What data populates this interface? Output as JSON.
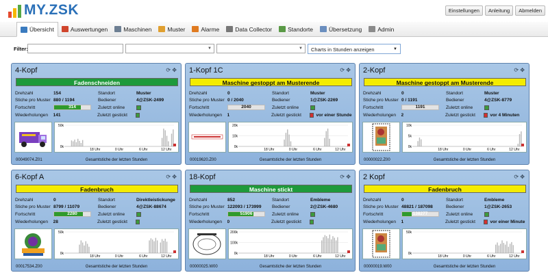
{
  "app": {
    "logo": "MY.ZSK",
    "buttons": [
      "Einstellungen",
      "Anleitung",
      "Abmelden"
    ]
  },
  "nav": [
    {
      "label": "Übersicht",
      "icon": "home-icon",
      "color": "#3b7bbf",
      "active": true
    },
    {
      "label": "Auswertungen",
      "icon": "bar-chart-icon",
      "color": "#d0452c"
    },
    {
      "label": "Maschinen",
      "icon": "machine-icon",
      "color": "#6d7f93"
    },
    {
      "label": "Muster",
      "icon": "pattern-icon",
      "color": "#e0a030"
    },
    {
      "label": "Alarme",
      "icon": "alarm-icon",
      "color": "#e07b21"
    },
    {
      "label": "Data Collector",
      "icon": "gear-icon",
      "color": "#777777"
    },
    {
      "label": "Standorte",
      "icon": "location-icon",
      "color": "#5a9a46"
    },
    {
      "label": "Übersetzung",
      "icon": "translate-icon",
      "color": "#6b8fbf"
    },
    {
      "label": "Admin",
      "icon": "admin-icon",
      "color": "#8b8b8b"
    }
  ],
  "filter": {
    "label": "Filter:",
    "chart_mode": "Charts in Stunden anzeigen"
  },
  "labels": {
    "drehzahl": "Drehzahl",
    "stiche": "Stiche pro Muster",
    "fortschritt": "Fortschritt",
    "wiederholungen": "Wiederholungen",
    "standort": "Standort",
    "bediener": "Bediener",
    "online": "Zuletzt online",
    "gestickt": "Zuletzt gestickt",
    "chart_caption": "Gesamtstiche der letzten Stunden"
  },
  "colors": {
    "green": "#1e9a3b",
    "yellow": "#f4ec00"
  },
  "machines": [
    {
      "name": "4-Kopf",
      "status": "Fadenschneiden",
      "status_color": "green",
      "drehzahl": "154",
      "stiche": "880 / 1194",
      "progress": "314",
      "progress_pct": 0.74,
      "wiederholungen": "141",
      "standort": "Muster",
      "bediener": "4@ZSK-2499",
      "online": "g",
      "gestickt": "g",
      "gestickt_text": "",
      "image_id": "00049074.Z01",
      "image": "truck",
      "chart_data": {
        "type": "bar",
        "ylabel_ticks": [
          "50k",
          "0k"
        ],
        "x_ticks": [
          "18 Uhr",
          "0 Uhr",
          "6 Uhr",
          "12 Uhr"
        ],
        "ylim": [
          0,
          50000
        ],
        "values": [
          0,
          0,
          0,
          0,
          14000,
          12000,
          16000,
          10000,
          18000,
          13000,
          8000,
          15000,
          0,
          0,
          0,
          0,
          0,
          0,
          0,
          0,
          0,
          0,
          0,
          0,
          0,
          0,
          0,
          0,
          0,
          0,
          0,
          0,
          0,
          0,
          0,
          0,
          0,
          0,
          0,
          0,
          0,
          0,
          0,
          0,
          0,
          0,
          0,
          0,
          0,
          0,
          0,
          0,
          0,
          0,
          0,
          0,
          0,
          0,
          0,
          0,
          0,
          20000,
          42000,
          38000,
          25000,
          12000,
          0,
          30000,
          40000
        ]
      }
    },
    {
      "name": "1-Kopf 1C",
      "status": "Maschine gestoppt am Musterende",
      "status_color": "yellow",
      "drehzahl": "0",
      "stiche": "0 / 2040",
      "progress": "2040",
      "progress_pct": 1.0,
      "progress_gray": true,
      "wiederholungen": "1",
      "standort": "Muster",
      "bediener": "1@ZSK-2269",
      "online": "g",
      "gestickt": "r",
      "gestickt_text": "vor einer Stunde",
      "image_id": "00019620.Z00",
      "image": "text",
      "chart_data": {
        "type": "bar",
        "ylabel_ticks": [
          "20k",
          "10k",
          "0k"
        ],
        "x_ticks": [
          "18 Uhr",
          "0 Uhr",
          "6 Uhr",
          "12 Uhr"
        ],
        "ylim": [
          0,
          25000
        ],
        "values": [
          0,
          0,
          0,
          0,
          0,
          0,
          0,
          0,
          0,
          0,
          0,
          0,
          0,
          0,
          0,
          0,
          0,
          0,
          0,
          0,
          0,
          0,
          0,
          0,
          0,
          0,
          0,
          0,
          8000,
          16000,
          20000,
          14000,
          6000,
          0,
          0,
          0,
          0,
          0,
          0,
          0,
          0,
          0,
          0,
          0,
          0,
          0,
          0,
          0,
          0,
          0,
          0,
          0,
          0,
          10000,
          18000,
          21000,
          9000,
          0,
          0,
          0,
          0,
          0,
          0,
          0,
          0,
          0,
          0,
          0
        ]
      }
    },
    {
      "name": "2-Kopf",
      "status": "Maschine gestoppt am Musterende",
      "status_color": "yellow",
      "drehzahl": "0",
      "stiche": "0 / 1191",
      "progress": "1191",
      "progress_pct": 1.0,
      "progress_gray": true,
      "wiederholungen": "2",
      "standort": "Muster",
      "bediener": "4@ZSK-8779",
      "online": "g",
      "gestickt": "r",
      "gestickt_text": "vor 4 Minuten",
      "image_id": "00000022.Z00",
      "image": "stamp",
      "chart_data": {
        "type": "bar",
        "ylabel_ticks": [
          "10k",
          "5k",
          "0k"
        ],
        "x_ticks": [
          "18 Uhr",
          "0 Uhr",
          "6 Uhr",
          "12 Uhr"
        ],
        "ylim": [
          0,
          12000
        ],
        "values": [
          0,
          0,
          0,
          3000,
          5000,
          4000,
          0,
          0,
          0,
          0,
          0,
          0,
          0,
          0,
          0,
          0,
          0,
          0,
          0,
          0,
          0,
          0,
          0,
          0,
          0,
          0,
          0,
          0,
          0,
          0,
          0,
          0,
          0,
          0,
          0,
          0,
          0,
          0,
          0,
          0,
          0,
          0,
          0,
          0,
          0,
          0,
          0,
          0,
          0,
          0,
          0,
          0,
          0,
          0,
          0,
          0,
          0,
          0,
          0,
          0,
          0,
          0,
          0,
          0,
          0,
          0,
          1500,
          7000,
          8500
        ]
      }
    },
    {
      "name": "6-Kopf A",
      "status": "Fadenbruch",
      "status_color": "yellow",
      "drehzahl": "0",
      "stiche": "8799 / 11079",
      "progress": "2280",
      "progress_pct": 0.79,
      "wiederholungen": "28",
      "standort": "Direktleistickunge",
      "bediener": "4@ZSK-88674",
      "online": "g",
      "gestickt": "g",
      "gestickt_text": "",
      "image_id": "00017534.Z00",
      "image": "logo",
      "chart_data": {
        "type": "bar",
        "ylabel_ticks": [
          "50k",
          "0k"
        ],
        "x_ticks": [
          "18 Uhr",
          "0 Uhr",
          "6 Uhr",
          "12 Uhr"
        ],
        "ylim": [
          0,
          50000
        ],
        "values": [
          0,
          0,
          0,
          0,
          0,
          0,
          0,
          0,
          0,
          20000,
          30000,
          25000,
          18000,
          28000,
          22000,
          15000,
          0,
          0,
          0,
          0,
          0,
          0,
          0,
          0,
          0,
          0,
          0,
          0,
          0,
          0,
          0,
          0,
          0,
          0,
          0,
          0,
          0,
          0,
          0,
          0,
          0,
          0,
          0,
          0,
          0,
          0,
          0,
          0,
          0,
          0,
          0,
          0,
          0,
          30000,
          35000,
          32000,
          28000,
          36000,
          30000,
          0,
          25000,
          33000,
          29000,
          34000,
          27000,
          0,
          0,
          0,
          0
        ]
      }
    },
    {
      "name": "18-Kopf",
      "status": "Maschine stickt",
      "status_color": "green",
      "drehzahl": "852",
      "stiche": "122093 / 173999",
      "progress": "51906",
      "progress_pct": 0.7,
      "wiederholungen": "0",
      "standort": "Embleme",
      "bediener": "2@ZSK-4680",
      "online": "g",
      "gestickt": "g",
      "gestickt_text": "",
      "image_id": "00000025.W00",
      "image": "circle",
      "chart_data": {
        "type": "bar",
        "ylabel_ticks": [
          "200k",
          "100k",
          "0k"
        ],
        "x_ticks": [
          "18 Uhr",
          "0 Uhr",
          "6 Uhr",
          "12 Uhr"
        ],
        "ylim": [
          0,
          200000
        ],
        "values": [
          0,
          0,
          0,
          0,
          0,
          0,
          0,
          0,
          0,
          0,
          0,
          0,
          0,
          0,
          0,
          0,
          0,
          0,
          0,
          0,
          0,
          0,
          0,
          0,
          0,
          0,
          0,
          0,
          0,
          0,
          0,
          0,
          0,
          0,
          0,
          0,
          0,
          0,
          0,
          0,
          0,
          0,
          0,
          0,
          0,
          0,
          0,
          0,
          0,
          0,
          0,
          0,
          120000,
          150000,
          170000,
          160000,
          140000,
          175000,
          130000,
          160000,
          145000,
          120000,
          150000,
          0,
          0,
          0,
          0,
          0,
          0
        ]
      }
    },
    {
      "name": "2 Kopf",
      "status": "Fadenbruch",
      "status_color": "yellow",
      "drehzahl": "0",
      "stiche": "48821 / 187098",
      "progress": "138277",
      "progress_pct": 0.26,
      "wiederholungen": "1",
      "standort": "Embleme",
      "bediener": "1@ZSK-2653",
      "online": "g",
      "gestickt": "r",
      "gestickt_text": "vor einer Minute",
      "image_id": "00000019.W00",
      "image": "stamp",
      "chart_data": {
        "type": "bar",
        "ylabel_ticks": [
          "50k",
          "0k"
        ],
        "x_ticks": [
          "18 Uhr",
          "0 Uhr",
          "6 Uhr",
          "12 Uhr"
        ],
        "ylim": [
          0,
          50000
        ],
        "values": [
          0,
          0,
          0,
          0,
          0,
          0,
          0,
          0,
          0,
          0,
          0,
          0,
          0,
          0,
          0,
          0,
          0,
          0,
          0,
          0,
          0,
          0,
          0,
          0,
          0,
          0,
          0,
          0,
          0,
          0,
          0,
          0,
          0,
          0,
          0,
          0,
          0,
          0,
          0,
          0,
          0,
          0,
          0,
          0,
          0,
          0,
          0,
          0,
          0,
          0,
          0,
          0,
          20000,
          25000,
          18000,
          22000,
          30000,
          24000,
          20000,
          28000,
          15000,
          22000,
          26000,
          19000,
          0,
          0,
          0,
          0,
          0
        ]
      }
    }
  ]
}
